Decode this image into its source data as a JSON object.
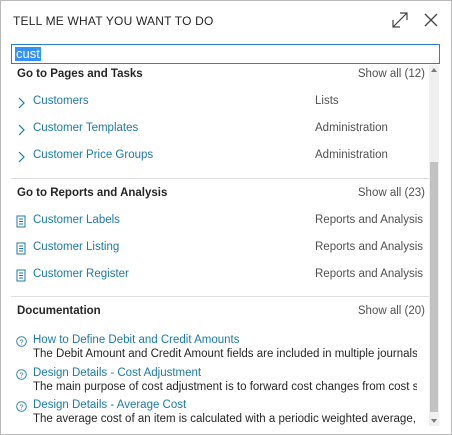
{
  "dialog": {
    "title": "TELL ME WHAT YOU WANT TO DO",
    "expand_icon": "expand-icon",
    "close_icon": "close-icon"
  },
  "search": {
    "value": "cust"
  },
  "sections": {
    "pages": {
      "title": "Go to Pages and Tasks",
      "show_all": "Show all (12)",
      "items": [
        {
          "label": "Customers",
          "category": "Lists"
        },
        {
          "label": "Customer Templates",
          "category": "Administration"
        },
        {
          "label": "Customer Price Groups",
          "category": "Administration"
        }
      ]
    },
    "reports": {
      "title": "Go to Reports and Analysis",
      "show_all": "Show all (23)",
      "items": [
        {
          "label": "Customer Labels",
          "category": "Reports and Analysis"
        },
        {
          "label": "Customer Listing",
          "category": "Reports and Analysis"
        },
        {
          "label": "Customer Register",
          "category": "Reports and Analysis"
        }
      ]
    },
    "documentation": {
      "title": "Documentation",
      "show_all": "Show all (20)",
      "items": [
        {
          "title": "How to Define Debit and Credit Amounts",
          "description": "The Debit Amount and Credit Amount fields are included in multiple journals and table..."
        },
        {
          "title": "Design Details - Cost Adjustment",
          "description": "The main purpose of cost adjustment is to forward cost changes from cost sources to c..."
        },
        {
          "title": "Design Details - Average Cost",
          "description": "The average cost of an item is calculated with a periodic weighted average, based on t..."
        }
      ]
    }
  },
  "colors": {
    "link": "#1b7aa7",
    "selection": "#3390ff",
    "focus_border": "#2b7cd3"
  }
}
